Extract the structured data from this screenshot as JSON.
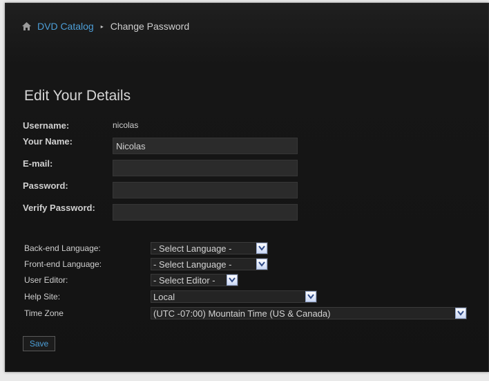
{
  "breadcrumb": {
    "home_icon": "home-icon",
    "link": "DVD Catalog",
    "current": "Change Password"
  },
  "title": "Edit Your Details",
  "details": {
    "username_label": "Username:",
    "username_value": "nicolas",
    "name_label": "Your Name:",
    "name_value": "Nicolas",
    "email_label": "E-mail:",
    "email_value": "",
    "password_label": "Password:",
    "verify_label": "Verify Password:"
  },
  "params": {
    "backend_label": "Back-end Language:",
    "backend_value": "- Select Language -",
    "frontend_label": "Front-end Language:",
    "frontend_value": "- Select Language -",
    "editor_label": "User Editor:",
    "editor_value": "- Select Editor -",
    "helpsite_label": "Help Site:",
    "helpsite_value": "Local",
    "timezone_label": "Time Zone",
    "timezone_value": "(UTC -07:00) Mountain Time (US & Canada)"
  },
  "save_label": "Save",
  "colors": {
    "link": "#4d9fd8",
    "panel_bg": "#161616",
    "input_bg": "#2b2b2b"
  }
}
